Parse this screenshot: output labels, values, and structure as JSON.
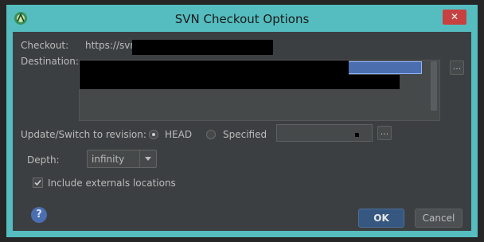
{
  "window": {
    "title": "SVN Checkout Options",
    "close_label": "✕"
  },
  "checkout": {
    "label": "Checkout:",
    "url_visible": "https://svn."
  },
  "destination": {
    "label": "Destination:",
    "browse_label": "..."
  },
  "revision": {
    "label": "Update/Switch to revision:",
    "options": [
      {
        "label": "HEAD",
        "selected": true
      },
      {
        "label": "Specified",
        "selected": false
      }
    ],
    "browse_label": "..."
  },
  "depth": {
    "label": "Depth:",
    "value": "infinity"
  },
  "externals": {
    "label": "Include externals locations",
    "checked": true
  },
  "buttons": {
    "help_label": "?",
    "ok_label": "OK",
    "cancel_label": "Cancel"
  }
}
